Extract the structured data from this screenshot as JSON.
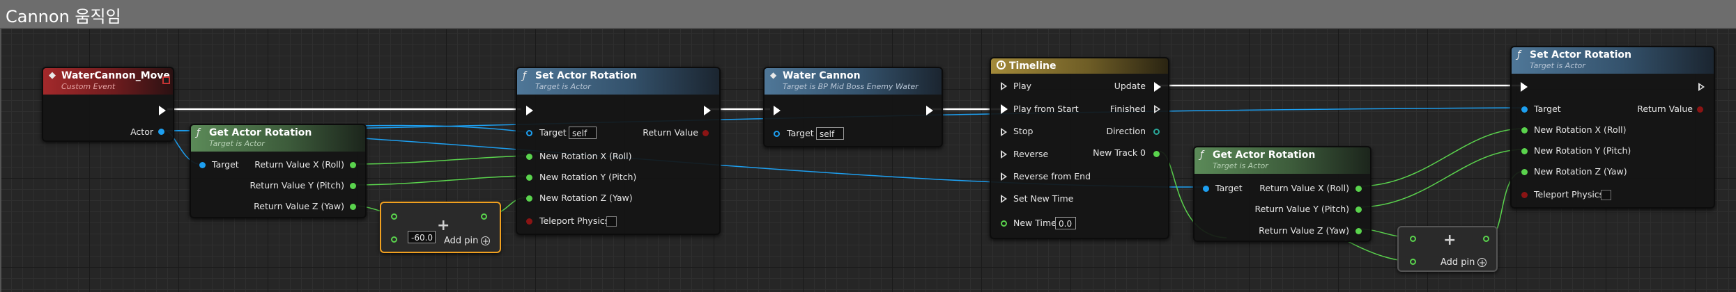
{
  "comment": {
    "title": "Cannon 움직임"
  },
  "colors": {
    "exec": "#ffffff",
    "object_pin": "#1d9ff0",
    "float_pin": "#5ad34d",
    "bool_pin": "#8b1414",
    "function_header": "#4f7798",
    "event_header": "#a3292b",
    "timeline_header": "#a38a3a",
    "selection_outline": "#f0a020"
  },
  "nodes": {
    "event": {
      "title": "WaterCannon_Move",
      "subtitle": "Custom Event",
      "icon": "event-diamond-icon",
      "actor_label": "Actor"
    },
    "get_rot1": {
      "icon": "function-icon",
      "title": "Get Actor Rotation",
      "subtitle": "Target is Actor",
      "target": "Target",
      "out_x": "Return Value X (Roll)",
      "out_y": "Return Value Y (Pitch)",
      "out_z": "Return Value Z (Yaw)"
    },
    "add1": {
      "value": "-60.0",
      "add_pin": "Add pin",
      "plus": "+"
    },
    "set_rot1": {
      "icon": "function-icon",
      "title": "Set Actor Rotation",
      "subtitle": "Target is Actor",
      "target": "Target",
      "target_value": "self",
      "return": "Return Value",
      "in_x": "New Rotation X (Roll)",
      "in_y": "New Rotation Y (Pitch)",
      "in_z": "New Rotation Z (Yaw)",
      "teleport": "Teleport Physics"
    },
    "water_cannon": {
      "icon": "variable-diamond-icon",
      "title": "Water Cannon",
      "subtitle": "Target is BP Mid Boss Enemy Water",
      "target": "Target",
      "target_value": "self"
    },
    "timeline": {
      "icon": "clock-icon",
      "title": "Timeline",
      "play": "Play",
      "play_from_start": "Play from Start",
      "stop": "Stop",
      "reverse": "Reverse",
      "reverse_from_end": "Reverse from End",
      "set_new_time": "Set New Time",
      "new_time": "New Time",
      "new_time_value": "0.0",
      "update": "Update",
      "finished": "Finished",
      "direction": "Direction",
      "new_track": "New Track 0"
    },
    "get_rot2": {
      "icon": "function-icon",
      "title": "Get Actor Rotation",
      "subtitle": "Target is Actor",
      "target": "Target",
      "out_x": "Return Value X (Roll)",
      "out_y": "Return Value Y (Pitch)",
      "out_z": "Return Value Z (Yaw)"
    },
    "add2": {
      "add_pin": "Add pin",
      "plus": "+"
    },
    "set_rot2": {
      "icon": "function-icon",
      "title": "Set Actor Rotation",
      "subtitle": "Target is Actor",
      "target": "Target",
      "return": "Return Value",
      "in_x": "New Rotation X (Roll)",
      "in_y": "New Rotation Y (Pitch)",
      "in_z": "New Rotation Z (Yaw)",
      "teleport": "Teleport Physics"
    }
  }
}
